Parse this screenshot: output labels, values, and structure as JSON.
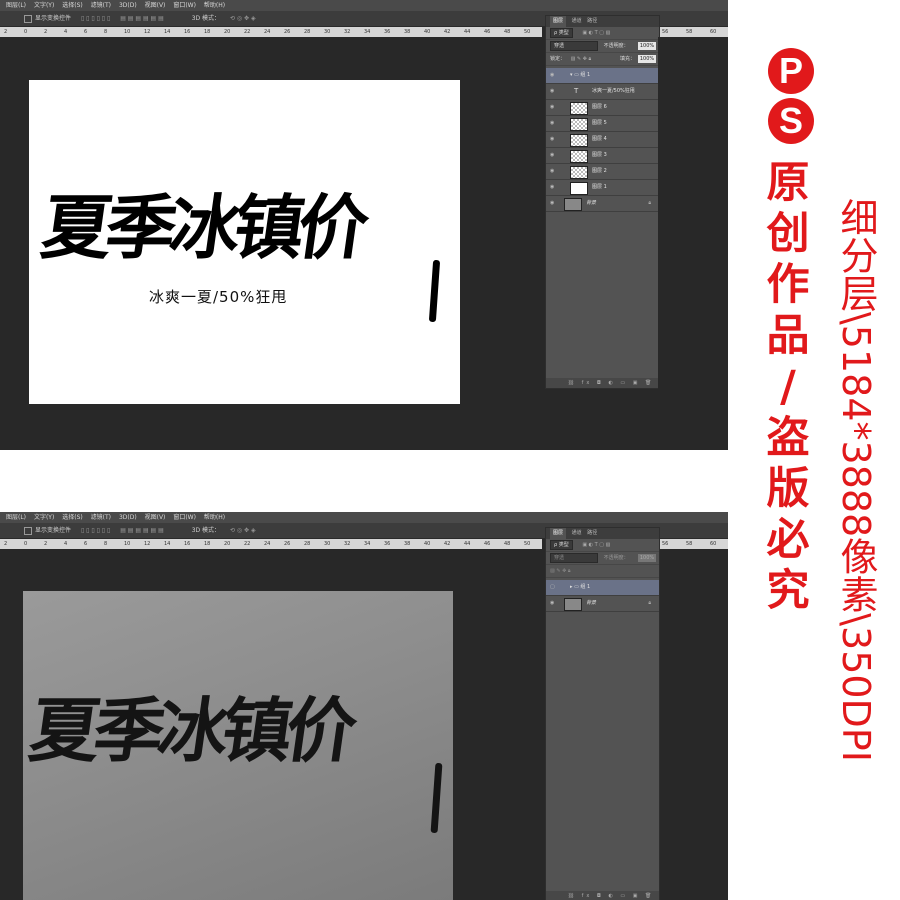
{
  "photoshop": {
    "menu": [
      "图层(L)",
      "文字(Y)",
      "选择(S)",
      "滤镜(T)",
      "3D(D)",
      "视图(V)",
      "窗口(W)",
      "帮助(H)"
    ],
    "options": {
      "show_transform": "显示变换控件",
      "mode_3d": "3D 模式："
    },
    "ruler_ticks": [
      "2",
      "0",
      "2",
      "4",
      "6",
      "8",
      "10",
      "12",
      "14",
      "16",
      "18",
      "20",
      "22",
      "24",
      "26",
      "28",
      "30",
      "32",
      "34",
      "36",
      "38",
      "40",
      "42",
      "44",
      "46",
      "48",
      "50"
    ],
    "ruler_right_ticks": [
      "56",
      "58",
      "60"
    ],
    "ruler_right_ticks_2": [
      "56",
      "58",
      "60"
    ]
  },
  "screen1": {
    "canvas_title": "夏季冰镇价",
    "canvas_subtitle": "冰爽一夏/50%狂甩",
    "panel": {
      "tabs": [
        "图层",
        "通道",
        "路径"
      ],
      "filter": "ρ 类型",
      "blend": "穿透",
      "opacity_label": "不透明度：",
      "opacity_value": "100%",
      "lock_label": "锁定：",
      "fill_label": "填充：",
      "fill_value": "100%",
      "layers": [
        "组 1",
        "冰爽一夏/50%狂甩",
        "图层 6",
        "图层 5",
        "图层 4",
        "图层 3",
        "图层 2",
        "图层 1",
        "背景"
      ]
    }
  },
  "screen2": {
    "canvas_title": "夏季冰镇价",
    "panel": {
      "tabs": [
        "图层",
        "通道",
        "路径"
      ],
      "filter": "ρ 类型",
      "blend": "穿透",
      "opacity_label": "不透明度：",
      "opacity_value": "100%",
      "layers": [
        "组 1",
        "背景"
      ]
    }
  },
  "brand": {
    "badge_p": "P",
    "badge_s": "S",
    "main_vertical": [
      "原",
      "创",
      "作",
      "品",
      "/",
      "盗",
      "版",
      "必",
      "究"
    ],
    "side_vertical": "细分层\\5184*3888像素\\350DPI",
    "accent_color": "#e1191b"
  }
}
